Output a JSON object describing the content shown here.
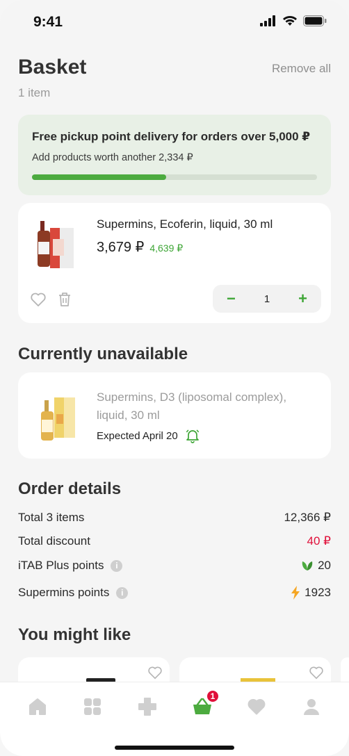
{
  "status_bar": {
    "time": "9:41"
  },
  "header": {
    "title": "Basket",
    "remove_all": "Remove all",
    "item_count": "1 item"
  },
  "promo": {
    "headline": "Free pickup point delivery for orders over 5,000 ₽",
    "subtext": "Add products worth another 2,334 ₽",
    "progress_fraction": 0.47
  },
  "basket_item": {
    "name": "Supermins, Ecoferin, liquid, 30 ml",
    "price": "3,679 ₽",
    "old_price": "4,639 ₽",
    "quantity": "1",
    "decrement": "−",
    "increment": "+"
  },
  "unavailable": {
    "title": "Currently unavailable",
    "name": "Supermins, D3 (liposomal complex), liquid, 30 ml",
    "expected": "Expected April 20"
  },
  "order_details": {
    "title": "Order details",
    "total_items_label": "Total 3 items",
    "total_items_value": "12,366 ₽",
    "discount_label": "Total discount",
    "discount_value": "40 ₽",
    "itab_label": "iTAB Plus points",
    "itab_value": "20",
    "supermins_label": "Supermins points",
    "supermins_value": "1923",
    "info_glyph": "i"
  },
  "suggestions": {
    "title": "You might like"
  },
  "tabbar": {
    "basket_badge": "1"
  },
  "colors": {
    "accent": "#4cab3f",
    "discount": "#e0103a",
    "promo_bg": "#e8f0e6"
  }
}
